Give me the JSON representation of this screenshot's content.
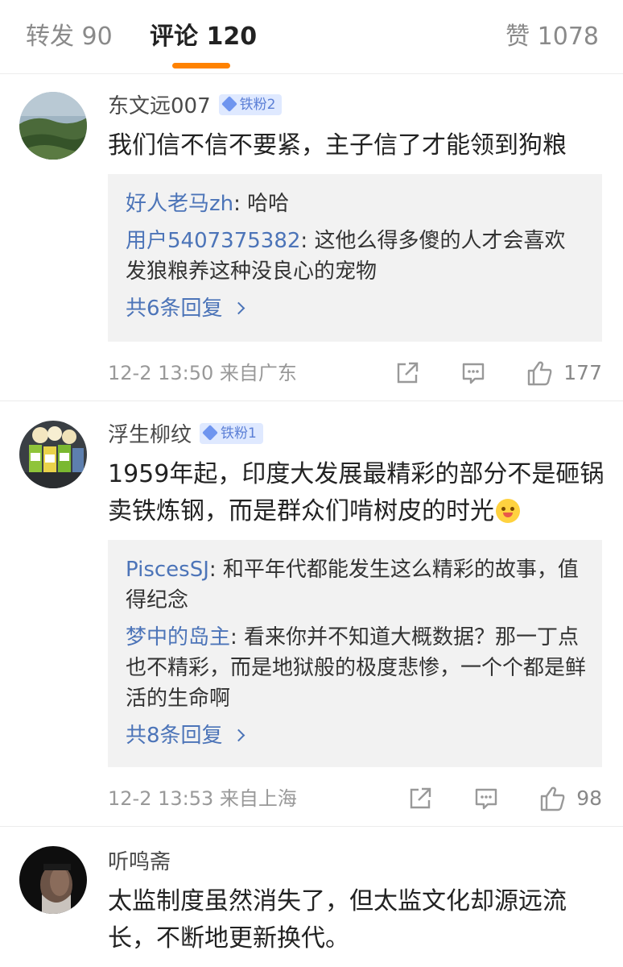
{
  "tabs": {
    "reposts": "转发 90",
    "comments": "评论 120",
    "likes": "赞 1078",
    "accent_color": "#ff8200"
  },
  "comments": [
    {
      "username": "东文远007",
      "badge": "铁粉2",
      "text": "我们信不信不要紧，主子信了才能领到狗粮",
      "replies": [
        {
          "name": "好人老马zh",
          "text": ": 哈哈"
        },
        {
          "name": "用户5407375382",
          "text": ": 这他么得多傻的人才会喜欢发狼粮养这种没良心的宠物"
        }
      ],
      "more": "共6条回复",
      "time": "12-2 13:50",
      "location": "来自广东",
      "likes": "177"
    },
    {
      "username": "浮生柳纹",
      "badge": "铁粉1",
      "text": "1959年起，印度大发展最精彩的部分不是砸锅卖铁炼钢，而是群众们啃树皮的时光",
      "replies": [
        {
          "name": "PiscesSJ",
          "text": ": 和平年代都能发生这么精彩的故事，值得纪念"
        },
        {
          "name": "梦中的岛主",
          "text": ": 看来你并不知道大概数据？那一丁点也不精彩，而是地狱般的极度悲惨，一个个都是鲜活的生命啊"
        }
      ],
      "more": "共8条回复",
      "time": "12-2 13:53",
      "location": "来自上海",
      "likes": "98"
    },
    {
      "username": "听鸣斋",
      "text": "太监制度虽然消失了，但太监文化却源远流长，不断地更新换代。"
    }
  ],
  "icons": {
    "share": "share-icon",
    "comment": "comment-icon",
    "like": "thumbs-up-icon"
  }
}
